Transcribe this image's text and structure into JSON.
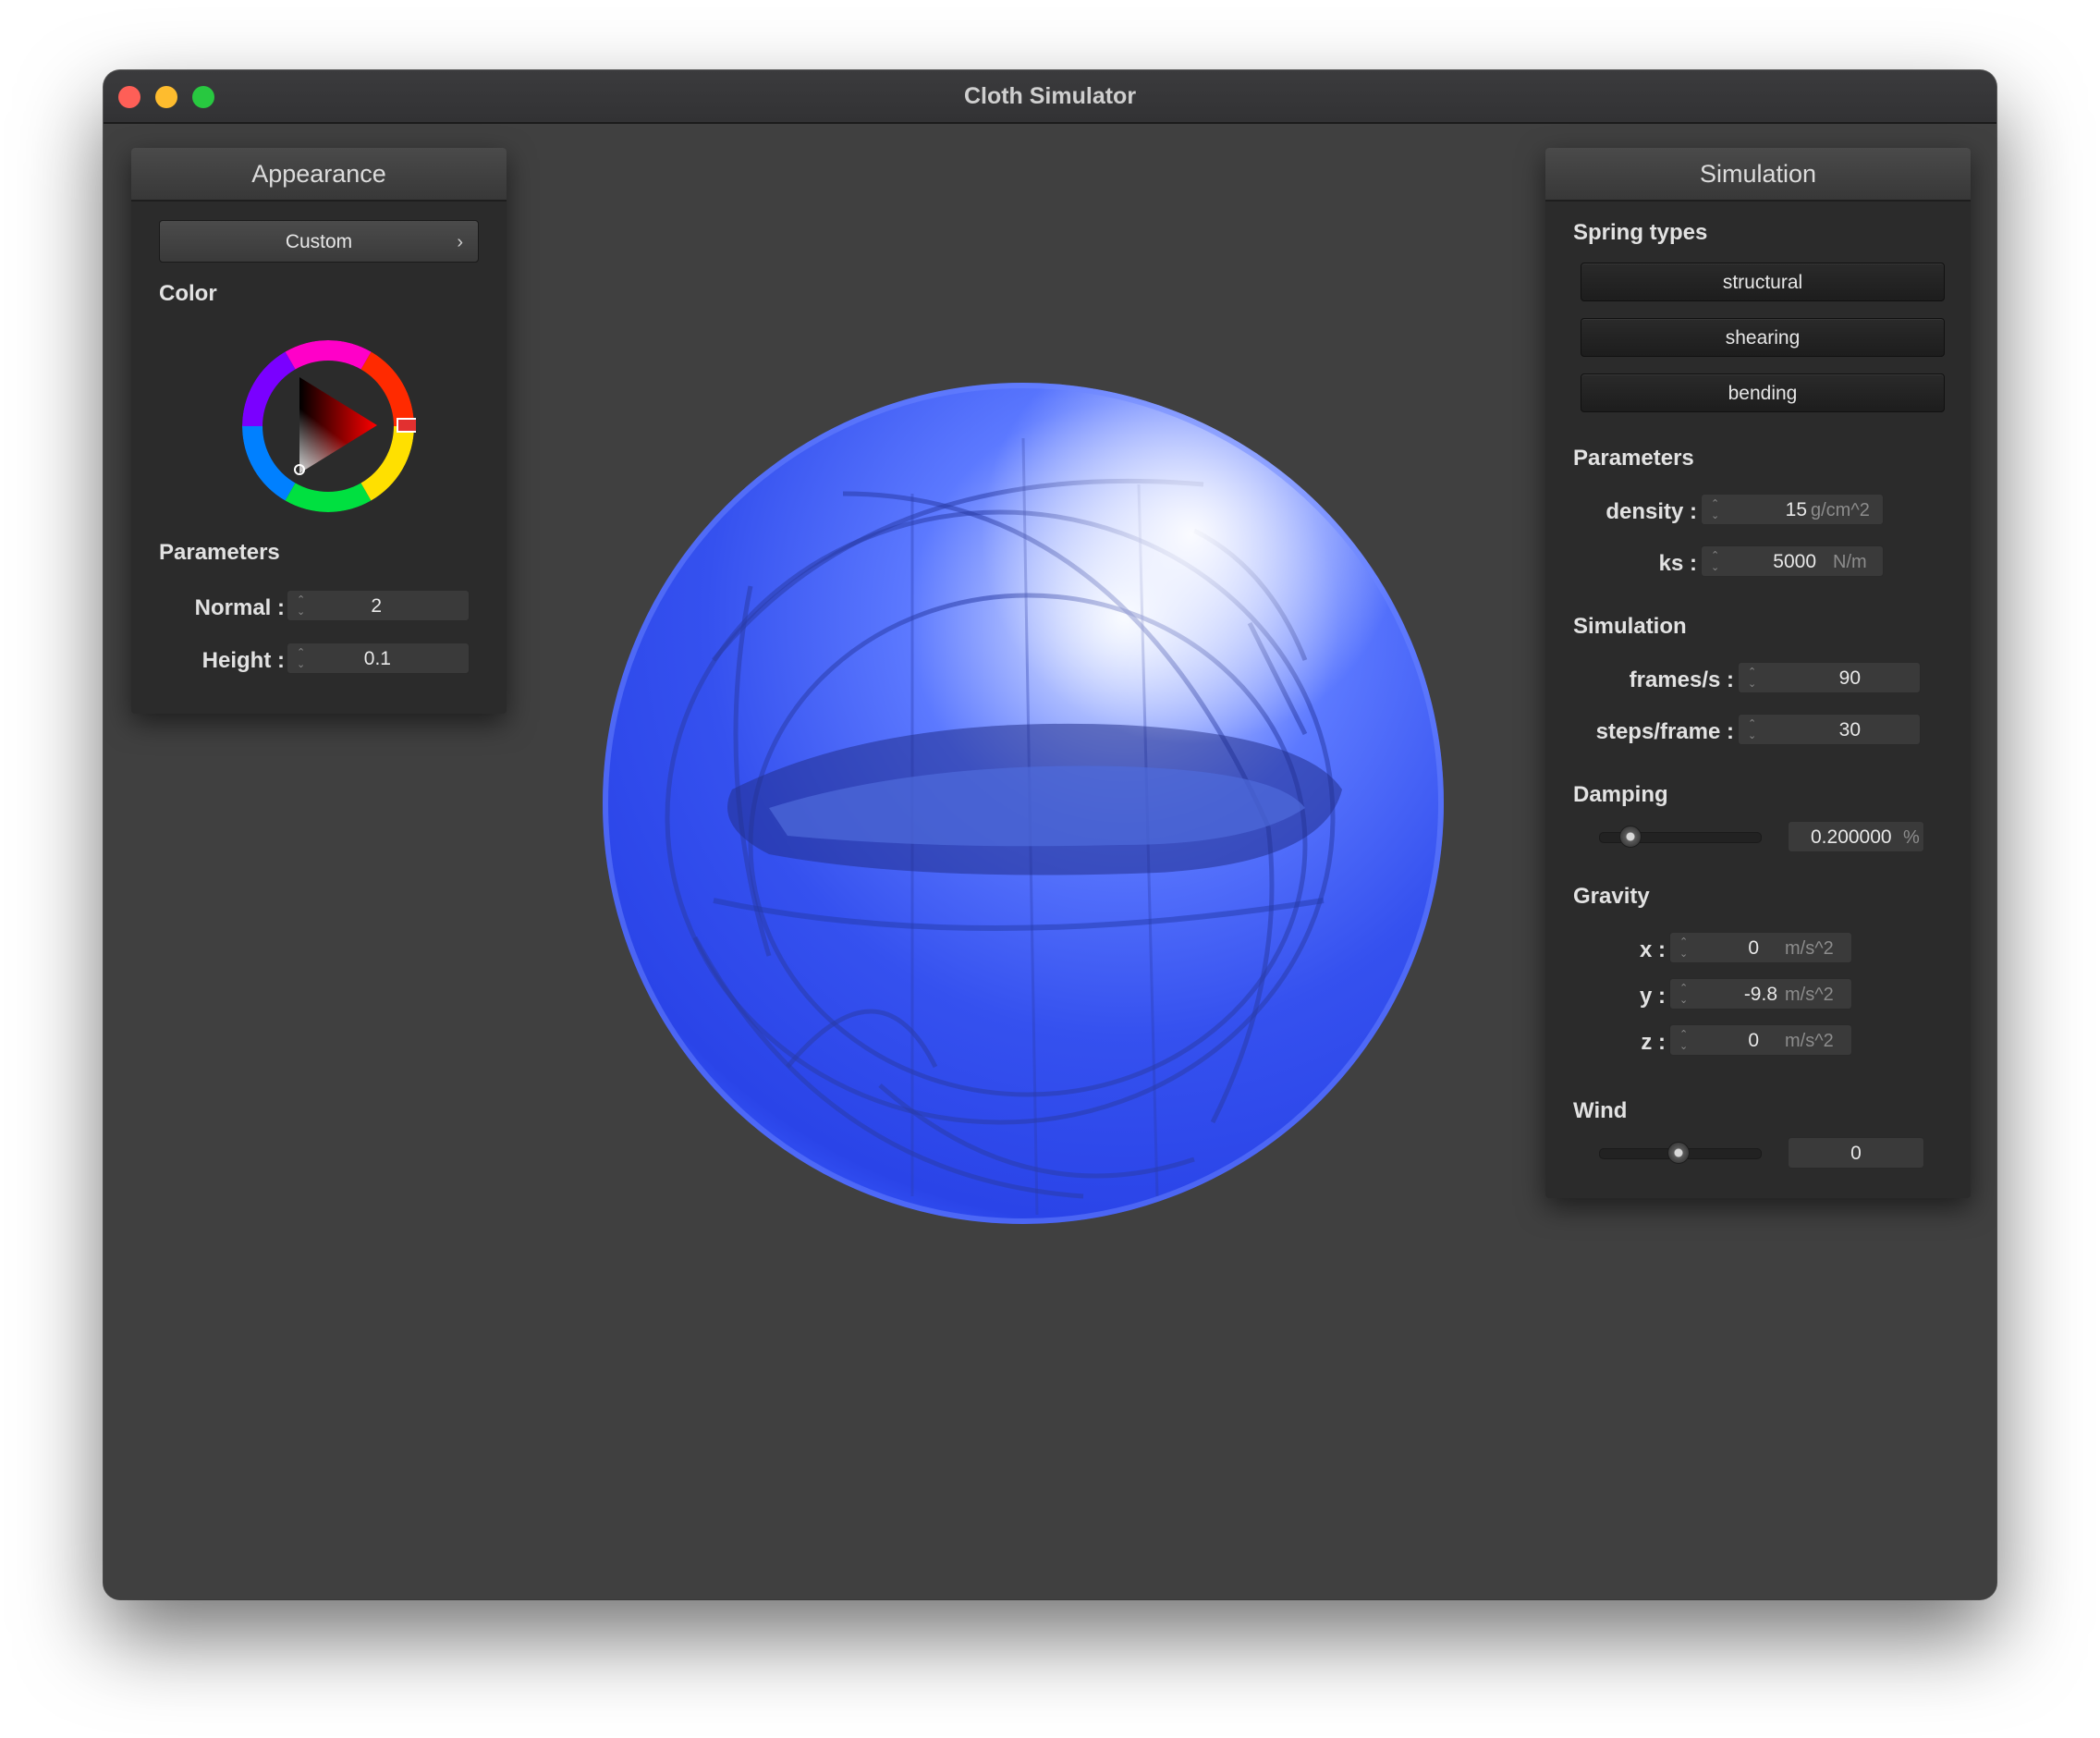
{
  "window": {
    "title": "Cloth Simulator"
  },
  "appearance": {
    "header": "Appearance",
    "preset": "Custom",
    "color_label": "Color",
    "parameters_label": "Parameters",
    "normal": {
      "label": "Normal :",
      "value": "2"
    },
    "height": {
      "label": "Height :",
      "value": "0.1"
    }
  },
  "simulation": {
    "header": "Simulation",
    "spring_types_label": "Spring types",
    "spring_types": [
      "structural",
      "shearing",
      "bending"
    ],
    "parameters_label": "Parameters",
    "density": {
      "label": "density :",
      "value": "15",
      "unit": "g/cm^2"
    },
    "ks": {
      "label": "ks :",
      "value": "5000",
      "unit": "N/m"
    },
    "simulation_label": "Simulation",
    "frames_per_s": {
      "label": "frames/s :",
      "value": "90"
    },
    "steps_per_frame": {
      "label": "steps/frame :",
      "value": "30"
    },
    "damping_label": "Damping",
    "damping": {
      "value": "0.200000",
      "unit": "%",
      "slider_level": 0.2
    },
    "gravity_label": "Gravity",
    "gravity": {
      "x": {
        "label": "x :",
        "value": "0",
        "unit": "m/s^2"
      },
      "y": {
        "label": "y :",
        "value": "-9.8",
        "unit": "m/s^2"
      },
      "z": {
        "label": "z :",
        "value": "0",
        "unit": "m/s^2"
      }
    },
    "wind_label": "Wind",
    "wind": {
      "value": "0",
      "slider_level": 0.5
    }
  },
  "colors": {
    "sphere": "#2f4dff",
    "window_bg": "#404040",
    "panel_bg": "#2b2b2b",
    "selected_color": "#ff0000"
  }
}
